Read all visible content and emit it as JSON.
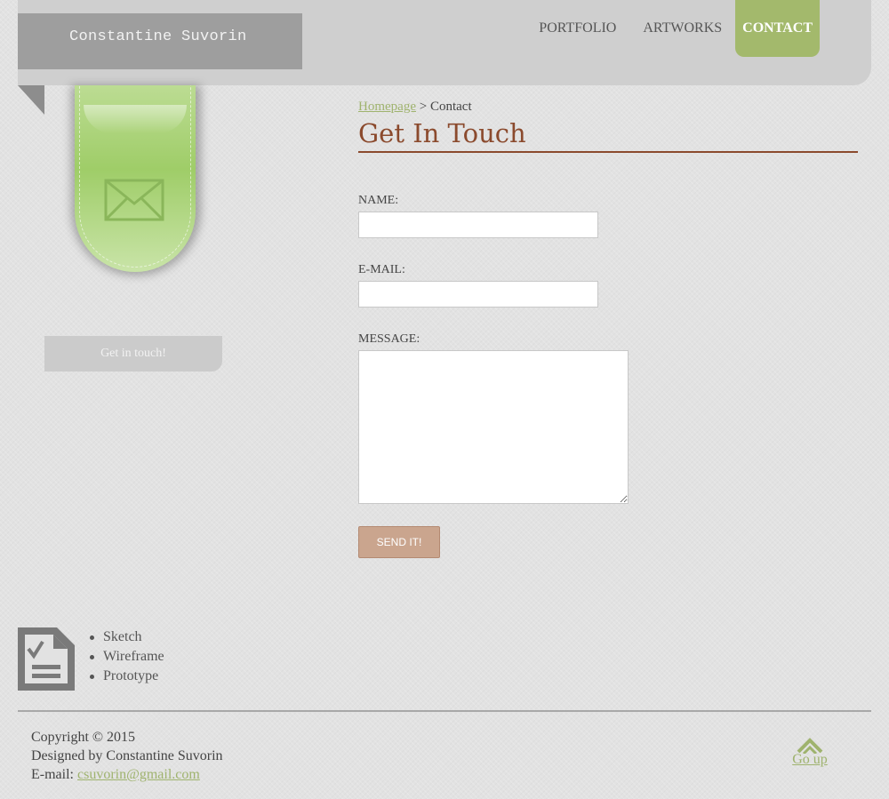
{
  "header": {
    "site_title": "Constantine Suvorin",
    "nav": [
      {
        "label": "PORTFOLIO",
        "active": false
      },
      {
        "label": "ARTWORKS",
        "active": false
      },
      {
        "label": "CONTACT",
        "active": true
      }
    ]
  },
  "sidebar": {
    "ribbon_icon": "envelope-icon",
    "button_label": "Get in touch!"
  },
  "breadcrumb": {
    "home": "Homepage",
    "separator": ">",
    "current": "Contact"
  },
  "page_title": "Get In Touch",
  "form": {
    "name_label": "NAME:",
    "name_value": "",
    "email_label": "E-MAIL:",
    "email_value": "",
    "message_label": "MESSAGE:",
    "message_value": "",
    "send_label": "SEND IT!"
  },
  "process": {
    "icon": "document-checklist-icon",
    "items": [
      "Sketch",
      "Wireframe",
      "Prototype"
    ]
  },
  "footer": {
    "copyright": "Copyright © 2015",
    "designed_by": "Designed by Constantine Suvorin",
    "email_prefix": "E-mail:",
    "email": "csuvorin@gmail.com",
    "go_up": "Go up"
  },
  "colors": {
    "accent_green": "#a3b96c",
    "title_brown": "#8b4a2d",
    "button_tan": "#caa58e",
    "header_gray": "#cfcfcf"
  }
}
